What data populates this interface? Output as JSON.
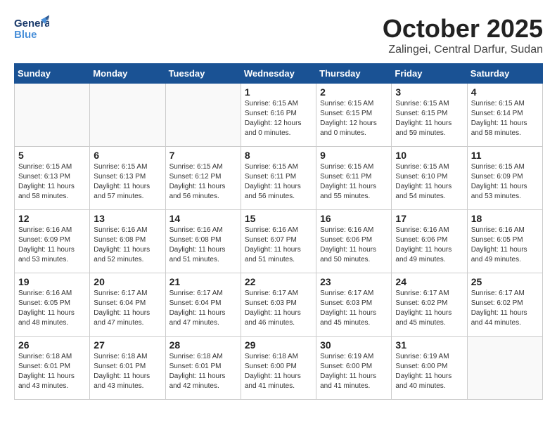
{
  "header": {
    "logo_line1": "General",
    "logo_line2": "Blue",
    "month": "October 2025",
    "location": "Zalingei, Central Darfur, Sudan"
  },
  "days_of_week": [
    "Sunday",
    "Monday",
    "Tuesday",
    "Wednesday",
    "Thursday",
    "Friday",
    "Saturday"
  ],
  "weeks": [
    [
      {
        "day": "",
        "info": ""
      },
      {
        "day": "",
        "info": ""
      },
      {
        "day": "",
        "info": ""
      },
      {
        "day": "1",
        "info": "Sunrise: 6:15 AM\nSunset: 6:16 PM\nDaylight: 12 hours\nand 0 minutes."
      },
      {
        "day": "2",
        "info": "Sunrise: 6:15 AM\nSunset: 6:15 PM\nDaylight: 12 hours\nand 0 minutes."
      },
      {
        "day": "3",
        "info": "Sunrise: 6:15 AM\nSunset: 6:15 PM\nDaylight: 11 hours\nand 59 minutes."
      },
      {
        "day": "4",
        "info": "Sunrise: 6:15 AM\nSunset: 6:14 PM\nDaylight: 11 hours\nand 58 minutes."
      }
    ],
    [
      {
        "day": "5",
        "info": "Sunrise: 6:15 AM\nSunset: 6:13 PM\nDaylight: 11 hours\nand 58 minutes."
      },
      {
        "day": "6",
        "info": "Sunrise: 6:15 AM\nSunset: 6:13 PM\nDaylight: 11 hours\nand 57 minutes."
      },
      {
        "day": "7",
        "info": "Sunrise: 6:15 AM\nSunset: 6:12 PM\nDaylight: 11 hours\nand 56 minutes."
      },
      {
        "day": "8",
        "info": "Sunrise: 6:15 AM\nSunset: 6:11 PM\nDaylight: 11 hours\nand 56 minutes."
      },
      {
        "day": "9",
        "info": "Sunrise: 6:15 AM\nSunset: 6:11 PM\nDaylight: 11 hours\nand 55 minutes."
      },
      {
        "day": "10",
        "info": "Sunrise: 6:15 AM\nSunset: 6:10 PM\nDaylight: 11 hours\nand 54 minutes."
      },
      {
        "day": "11",
        "info": "Sunrise: 6:15 AM\nSunset: 6:09 PM\nDaylight: 11 hours\nand 53 minutes."
      }
    ],
    [
      {
        "day": "12",
        "info": "Sunrise: 6:16 AM\nSunset: 6:09 PM\nDaylight: 11 hours\nand 53 minutes."
      },
      {
        "day": "13",
        "info": "Sunrise: 6:16 AM\nSunset: 6:08 PM\nDaylight: 11 hours\nand 52 minutes."
      },
      {
        "day": "14",
        "info": "Sunrise: 6:16 AM\nSunset: 6:08 PM\nDaylight: 11 hours\nand 51 minutes."
      },
      {
        "day": "15",
        "info": "Sunrise: 6:16 AM\nSunset: 6:07 PM\nDaylight: 11 hours\nand 51 minutes."
      },
      {
        "day": "16",
        "info": "Sunrise: 6:16 AM\nSunset: 6:06 PM\nDaylight: 11 hours\nand 50 minutes."
      },
      {
        "day": "17",
        "info": "Sunrise: 6:16 AM\nSunset: 6:06 PM\nDaylight: 11 hours\nand 49 minutes."
      },
      {
        "day": "18",
        "info": "Sunrise: 6:16 AM\nSunset: 6:05 PM\nDaylight: 11 hours\nand 49 minutes."
      }
    ],
    [
      {
        "day": "19",
        "info": "Sunrise: 6:16 AM\nSunset: 6:05 PM\nDaylight: 11 hours\nand 48 minutes."
      },
      {
        "day": "20",
        "info": "Sunrise: 6:17 AM\nSunset: 6:04 PM\nDaylight: 11 hours\nand 47 minutes."
      },
      {
        "day": "21",
        "info": "Sunrise: 6:17 AM\nSunset: 6:04 PM\nDaylight: 11 hours\nand 47 minutes."
      },
      {
        "day": "22",
        "info": "Sunrise: 6:17 AM\nSunset: 6:03 PM\nDaylight: 11 hours\nand 46 minutes."
      },
      {
        "day": "23",
        "info": "Sunrise: 6:17 AM\nSunset: 6:03 PM\nDaylight: 11 hours\nand 45 minutes."
      },
      {
        "day": "24",
        "info": "Sunrise: 6:17 AM\nSunset: 6:02 PM\nDaylight: 11 hours\nand 45 minutes."
      },
      {
        "day": "25",
        "info": "Sunrise: 6:17 AM\nSunset: 6:02 PM\nDaylight: 11 hours\nand 44 minutes."
      }
    ],
    [
      {
        "day": "26",
        "info": "Sunrise: 6:18 AM\nSunset: 6:01 PM\nDaylight: 11 hours\nand 43 minutes."
      },
      {
        "day": "27",
        "info": "Sunrise: 6:18 AM\nSunset: 6:01 PM\nDaylight: 11 hours\nand 43 minutes."
      },
      {
        "day": "28",
        "info": "Sunrise: 6:18 AM\nSunset: 6:01 PM\nDaylight: 11 hours\nand 42 minutes."
      },
      {
        "day": "29",
        "info": "Sunrise: 6:18 AM\nSunset: 6:00 PM\nDaylight: 11 hours\nand 41 minutes."
      },
      {
        "day": "30",
        "info": "Sunrise: 6:19 AM\nSunset: 6:00 PM\nDaylight: 11 hours\nand 41 minutes."
      },
      {
        "day": "31",
        "info": "Sunrise: 6:19 AM\nSunset: 6:00 PM\nDaylight: 11 hours\nand 40 minutes."
      },
      {
        "day": "",
        "info": ""
      }
    ]
  ]
}
